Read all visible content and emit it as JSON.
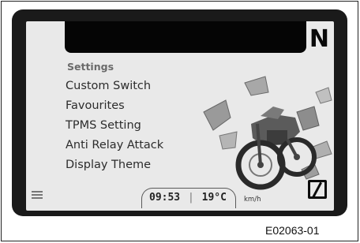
{
  "dashboard": {
    "gear_indicator": "N",
    "menu": {
      "title": "Settings",
      "items": [
        {
          "label": "Custom Switch"
        },
        {
          "label": "Favourites"
        },
        {
          "label": "TPMS Setting"
        },
        {
          "label": "Anti Relay Attack"
        },
        {
          "label": "Display Theme"
        }
      ]
    },
    "status": {
      "time": "09:53",
      "separator": "|",
      "temperature": "19°C",
      "speed_unit": "km/h"
    },
    "icons": {
      "bottom_left": "ride-mode-icon",
      "bottom_right": "zero-indicator-icon",
      "illustration": "exploded-motorcycle-illustration"
    }
  },
  "figure_id": "E02063-01"
}
